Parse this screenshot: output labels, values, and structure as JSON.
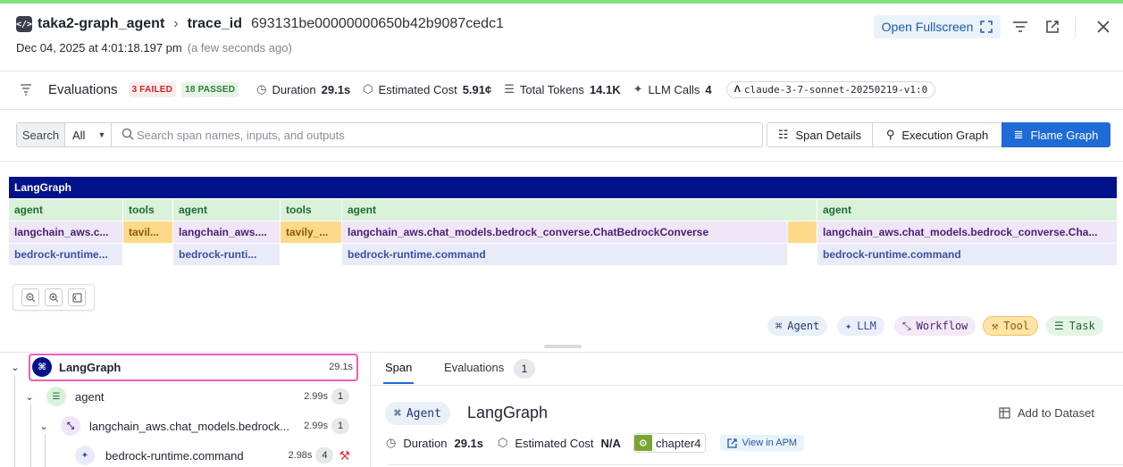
{
  "header": {
    "service": "taka2-graph_agent",
    "trace_label": "trace_id",
    "trace_id": "693131be00000000650b42b9087cedc1",
    "date": "Dec 04, 2025 at 4:01:18.197 pm",
    "ago": "(a few seconds ago)",
    "open_fullscreen": "Open Fullscreen"
  },
  "metrics": {
    "evaluations_label": "Evaluations",
    "failed": "3 FAILED",
    "passed": "18 PASSED",
    "duration_label": "Duration",
    "duration": "29.1s",
    "cost_label": "Estimated Cost",
    "cost": "5.91¢",
    "tokens_label": "Total Tokens",
    "tokens": "14.1K",
    "llm_calls_label": "LLM Calls",
    "llm_calls": "4",
    "model": "claude-3-7-sonnet-20250219-v1:0"
  },
  "search": {
    "label": "Search",
    "scope": "All",
    "placeholder": "Search span names, inputs, and outputs"
  },
  "views": {
    "span_details": "Span Details",
    "execution_graph": "Execution Graph",
    "flame_graph": "Flame Graph"
  },
  "flame": {
    "root": "LangGraph",
    "row1": [
      "agent",
      "tools",
      "agent",
      "tools",
      "agent",
      "agent"
    ],
    "row2": [
      "langchain_aws.c...",
      "tavil...",
      "langchain_aws....",
      "tavily_...",
      "langchain_aws.chat_models.bedrock_converse.ChatBedrockConverse",
      "langchain_aws.chat_models.bedrock_converse.Cha..."
    ],
    "row3": [
      "bedrock-runtime...",
      "bedrock-runti...",
      "bedrock-runtime.command",
      "bedrock-runtime.command"
    ]
  },
  "legend": {
    "agent": "Agent",
    "llm": "LLM",
    "workflow": "Workflow",
    "tool": "Tool",
    "task": "Task"
  },
  "tree": [
    {
      "label": "LangGraph",
      "duration": "29.1s",
      "count": ""
    },
    {
      "label": "agent",
      "duration": "2.99s",
      "count": "1"
    },
    {
      "label": "langchain_aws.chat_models.bedrock...",
      "duration": "2.99s",
      "count": "1"
    },
    {
      "label": "bedrock-runtime.command",
      "duration": "2.98s",
      "count": "4"
    }
  ],
  "detail": {
    "tab_span": "Span",
    "tab_evaluations": "Evaluations",
    "eval_count": "1",
    "kind": "Agent",
    "title": "LangGraph",
    "add_dataset": "Add to Dataset",
    "duration_label": "Duration",
    "duration": "29.1s",
    "cost_label": "Estimated Cost",
    "cost": "N/A",
    "chapter": "chapter4",
    "view_apm": "View in APM"
  },
  "colors": {
    "accent": "#1e6bd6",
    "root_bar": "#00128a",
    "tool": "#ffd98a",
    "selection": "#e85fbf"
  }
}
